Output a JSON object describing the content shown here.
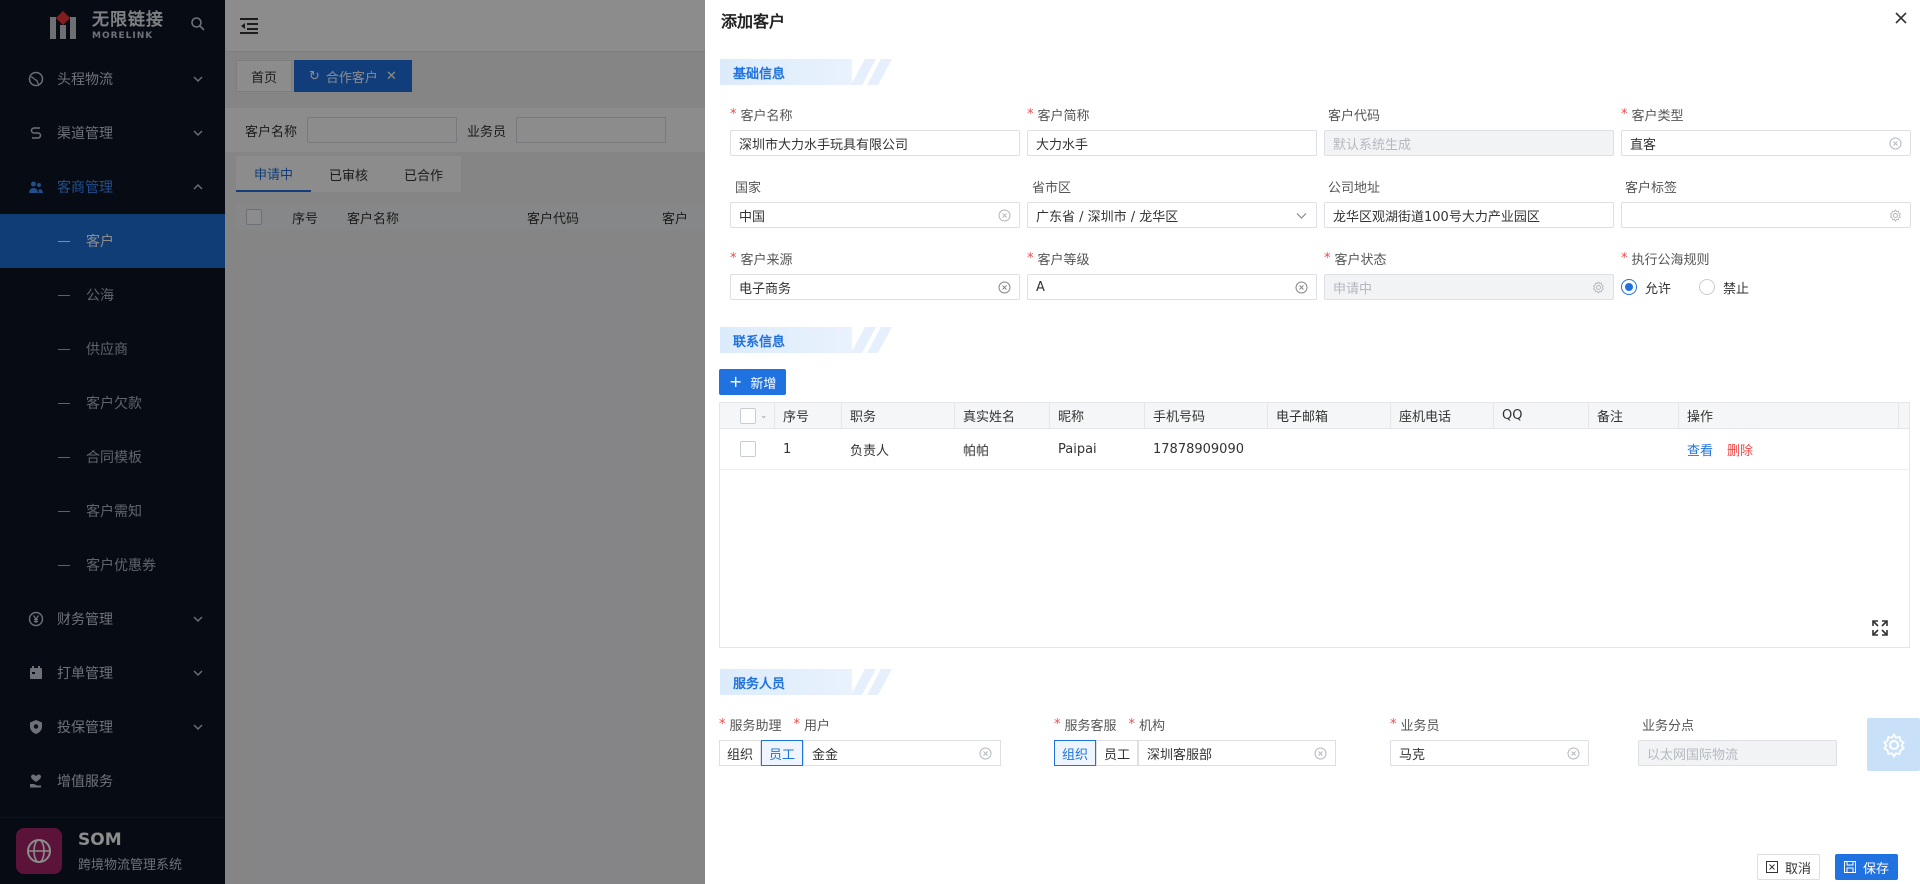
{
  "sidebar": {
    "logo_cn": "无限链接",
    "logo_en": "MORELINK",
    "nav": [
      {
        "label": "头程物流",
        "icon": "globe-icon"
      },
      {
        "label": "渠道管理",
        "icon": "route-icon"
      },
      {
        "label": "客商管理",
        "icon": "people-icon"
      }
    ],
    "sub": [
      "客户",
      "公海",
      "供应商",
      "客户欠款",
      "合同模板",
      "客户需知",
      "客户优惠券"
    ],
    "nav2": [
      {
        "label": "财务管理",
        "icon": "yen-icon"
      },
      {
        "label": "打单管理",
        "icon": "calendar-icon"
      },
      {
        "label": "投保管理",
        "icon": "shield-icon"
      },
      {
        "label": "增值服务",
        "icon": "heart-hand-icon"
      }
    ],
    "user_name": "SOM",
    "user_sub": "跨境物流管理系统"
  },
  "main": {
    "page_tabs": [
      "首页",
      "合作客户"
    ],
    "filter": {
      "customer_name": "客户名称",
      "salesman": "业务员"
    },
    "status_tabs": [
      "申请中",
      "已审核",
      "已合作"
    ],
    "grid_cols": [
      "序号",
      "客户名称",
      "客户代码",
      "客户"
    ]
  },
  "drawer": {
    "title": "添加客户",
    "sections": {
      "basic": "基础信息",
      "contact": "联系信息",
      "service": "服务人员"
    },
    "fields": {
      "name": {
        "label": "客户名称",
        "value": "深圳市大力水手玩具有限公司"
      },
      "short": {
        "label": "客户简称",
        "value": "大力水手"
      },
      "code": {
        "label": "客户代码",
        "placeholder": "默认系统生成"
      },
      "type": {
        "label": "客户类型",
        "value": "直客"
      },
      "country": {
        "label": "国家",
        "value": "中国"
      },
      "region": {
        "label": "省市区",
        "value": "广东省 / 深圳市 / 龙华区"
      },
      "address": {
        "label": "公司地址",
        "value": "龙华区观湖街道100号大力产业园区"
      },
      "tags": {
        "label": "客户标签",
        "value": ""
      },
      "source": {
        "label": "客户来源",
        "value": "电子商务"
      },
      "level": {
        "label": "客户等级",
        "value": "A"
      },
      "status": {
        "label": "客户状态",
        "placeholder": "申请中"
      },
      "rule": {
        "label": "执行公海规则",
        "opt_yes": "允许",
        "opt_no": "禁止"
      }
    },
    "add_label": "新增",
    "contact_table": {
      "cols": [
        "序号",
        "职务",
        "真实姓名",
        "昵称",
        "手机号码",
        "电子邮箱",
        "座机电话",
        "QQ",
        "备注",
        "操作"
      ],
      "rows": [
        {
          "idx": "1",
          "duty": "负责人",
          "name": "帕帕",
          "nick": "Paipai",
          "phone": "17878909090",
          "email": "",
          "tel": "",
          "qq": "",
          "note": "",
          "view": "查看",
          "del": "删除"
        }
      ]
    },
    "service": {
      "assistant_label": "服务助理",
      "user_label": "用户",
      "seg_org": "组织",
      "seg_emp": "员工",
      "assistant_value": "金金",
      "cs_label": "服务客服",
      "org_label": "机构",
      "cs_value": "深圳客服部",
      "salesman_label": "业务员",
      "salesman_value": "马克",
      "share_label": "业务分点",
      "share_placeholder": "以太网国际物流"
    },
    "cancel": "取消",
    "save": "保存"
  }
}
